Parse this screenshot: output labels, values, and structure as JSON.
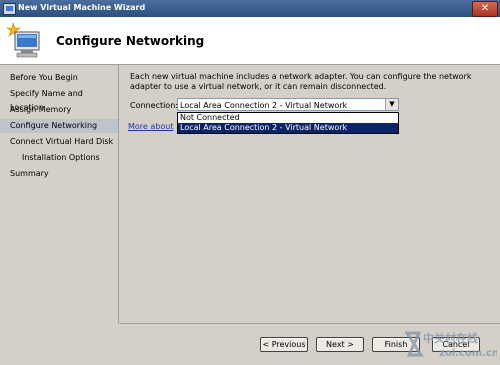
{
  "window": {
    "title": "New Virtual Machine Wizard"
  },
  "header": {
    "title": "Configure Networking"
  },
  "sidebar": {
    "items": [
      {
        "label": "Before You Begin"
      },
      {
        "label": "Specify Name and Location"
      },
      {
        "label": "Assign Memory"
      },
      {
        "label": "Configure Networking"
      },
      {
        "label": "Connect Virtual Hard Disk"
      },
      {
        "label": "Installation Options"
      },
      {
        "label": "Summary"
      }
    ]
  },
  "main": {
    "description": "Each new virtual machine includes a network adapter. You can configure the network adapter to use a virtual network, or it can remain disconnected.",
    "connection_label": "Connection:",
    "connection_value": "Local Area Connection 2 - Virtual Network",
    "options": [
      "Not Connected",
      "Local Area Connection 2 - Virtual Network"
    ],
    "link_visible": "More about"
  },
  "footer": {
    "previous": "< Previous",
    "next": "Next >",
    "finish": "Finish",
    "cancel": "Cancel"
  },
  "watermark": {
    "text": "中关村在线",
    "url": "zol.com.cn"
  },
  "colors": {
    "titlebar": "#2d4f7d",
    "selection": "#0a246a",
    "link": "#1a3ba8"
  }
}
